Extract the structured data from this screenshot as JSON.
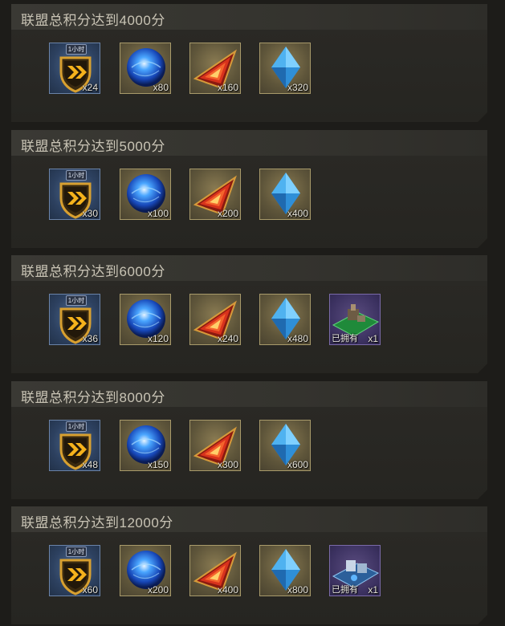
{
  "tiers": [
    {
      "title": "联盟总积分达到4000分",
      "rewards": [
        {
          "icon": "speedup-icon",
          "badge": "1小时",
          "qty": "x24"
        },
        {
          "icon": "blue-orb-icon",
          "qty": "x80"
        },
        {
          "icon": "red-shard-icon",
          "qty": "x160"
        },
        {
          "icon": "blue-crystal-icon",
          "qty": "x320"
        }
      ]
    },
    {
      "title": "联盟总积分达到5000分",
      "rewards": [
        {
          "icon": "speedup-icon",
          "badge": "1小时",
          "qty": "x30"
        },
        {
          "icon": "blue-orb-icon",
          "qty": "x100"
        },
        {
          "icon": "red-shard-icon",
          "qty": "x200"
        },
        {
          "icon": "blue-crystal-icon",
          "qty": "x400"
        }
      ]
    },
    {
      "title": "联盟总积分达到6000分",
      "rewards": [
        {
          "icon": "speedup-icon",
          "badge": "1小时",
          "qty": "x36"
        },
        {
          "icon": "blue-orb-icon",
          "qty": "x120"
        },
        {
          "icon": "red-shard-icon",
          "qty": "x240"
        },
        {
          "icon": "blue-crystal-icon",
          "qty": "x480"
        },
        {
          "icon": "base-skin-green-icon",
          "owned": "已拥有",
          "qty": "x1"
        }
      ]
    },
    {
      "title": "联盟总积分达到8000分",
      "rewards": [
        {
          "icon": "speedup-icon",
          "badge": "1小时",
          "qty": "x48"
        },
        {
          "icon": "blue-orb-icon",
          "qty": "x150"
        },
        {
          "icon": "red-shard-icon",
          "qty": "x300"
        },
        {
          "icon": "blue-crystal-icon",
          "qty": "x600"
        }
      ]
    },
    {
      "title": "联盟总积分达到12000分",
      "rewards": [
        {
          "icon": "speedup-icon",
          "badge": "1小时",
          "qty": "x60"
        },
        {
          "icon": "blue-orb-icon",
          "qty": "x200"
        },
        {
          "icon": "red-shard-icon",
          "qty": "x400"
        },
        {
          "icon": "blue-crystal-icon",
          "qty": "x800"
        },
        {
          "icon": "base-skin-blue-icon",
          "owned": "已拥有",
          "qty": "x1"
        }
      ]
    }
  ]
}
